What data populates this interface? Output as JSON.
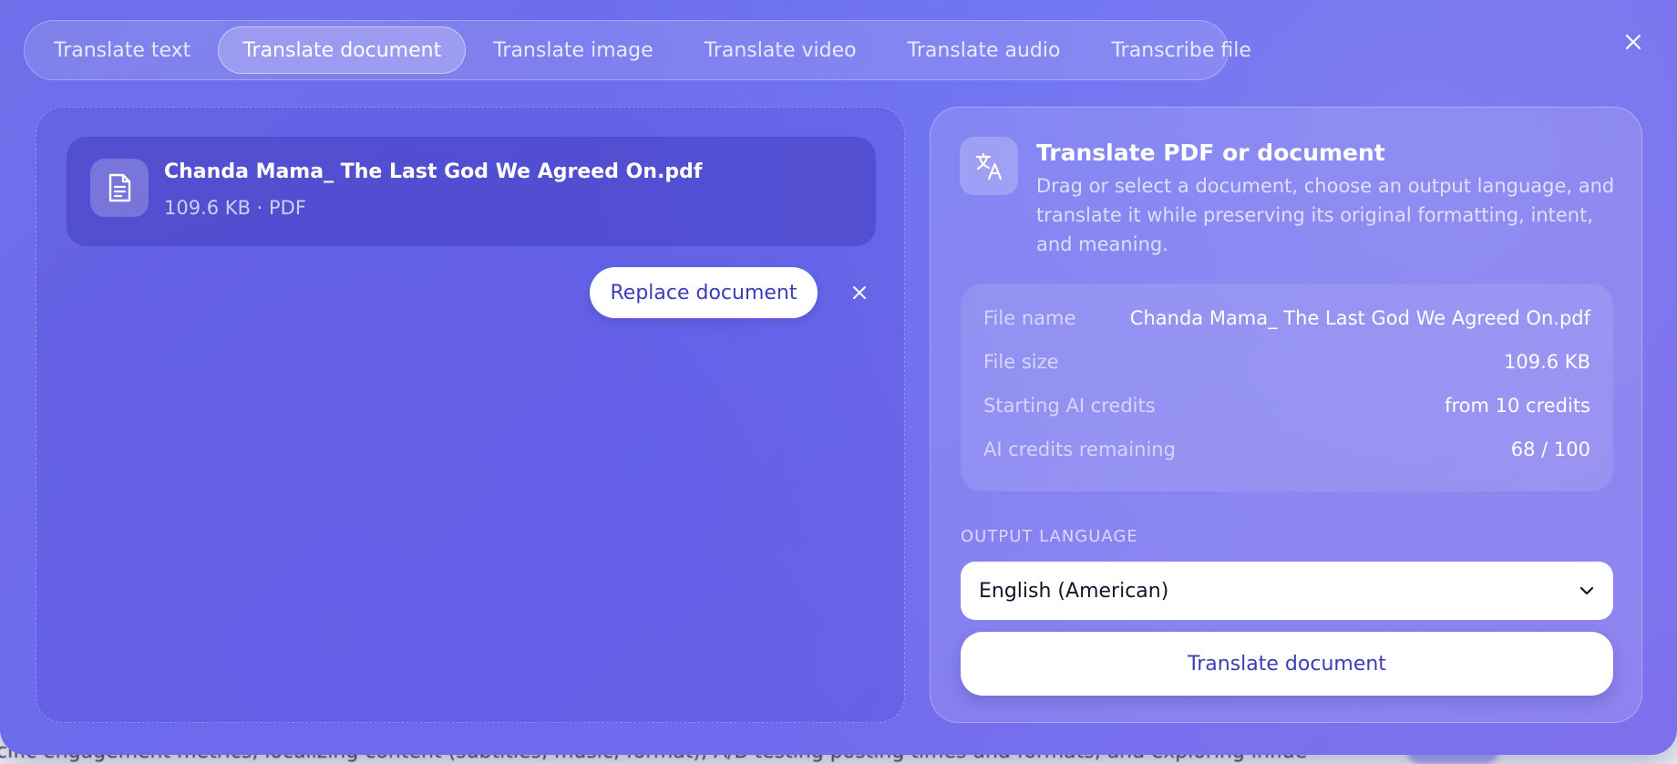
{
  "tabs": [
    {
      "label": "Translate text"
    },
    {
      "label": "Translate document",
      "active": true
    },
    {
      "label": "Translate image"
    },
    {
      "label": "Translate video"
    },
    {
      "label": "Translate audio"
    },
    {
      "label": "Transcribe file"
    }
  ],
  "upload": {
    "file_name": "Chanda Mama_ The Last God We Agreed On.pdf",
    "file_meta": "109.6 KB · PDF",
    "replace_label": "Replace document",
    "file_icon": "document-icon",
    "remove_icon": "close-icon"
  },
  "panel": {
    "icon": "translate-icon",
    "title": "Translate PDF or document",
    "description": "Drag or select a document, choose an output language, and translate it while preserving its original formatting, intent, and meaning.",
    "info": [
      {
        "label": "File name",
        "value": "Chanda Mama_ The Last God We Agreed On.pdf"
      },
      {
        "label": "File size",
        "value": "109.6 KB"
      },
      {
        "label": "Starting AI credits",
        "value": "from 10 credits"
      },
      {
        "label": "AI credits remaining",
        "value": "68 / 100"
      }
    ],
    "output_language_label": "OUTPUT LANGUAGE",
    "output_language_value": "English (American)",
    "translate_button": "Translate document"
  },
  "background": {
    "visible_text": "cific engagement metrics, localizing content (subtitles, music, format), A/B testing posting times and formats, and exploring influencer..."
  },
  "colors": {
    "modal_gradient_start": "#6d72ea",
    "modal_gradient_end": "#7b6cec",
    "accent_text": "#3c3cb8"
  }
}
